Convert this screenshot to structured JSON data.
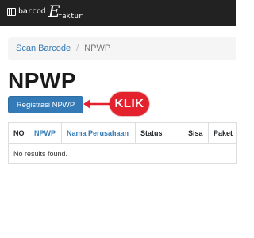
{
  "brand": {
    "part1": "barcod",
    "part2": "E",
    "part3": "faktur"
  },
  "breadcrumb": {
    "home": "Scan Barcode",
    "separator": "/",
    "current": "NPWP"
  },
  "page": {
    "title": "NPWP"
  },
  "toolbar": {
    "register_label": "Registrasi NPWP"
  },
  "annotation": {
    "callout": "KLIK"
  },
  "table": {
    "headers": [
      "NO",
      "NPWP",
      "Nama Perusahaan",
      "Status",
      "",
      "Sisa",
      "Paket"
    ],
    "empty_message": "No results found."
  },
  "colors": {
    "navbar": "#222222",
    "primary": "#337ab7",
    "callout": "#e4222e"
  }
}
